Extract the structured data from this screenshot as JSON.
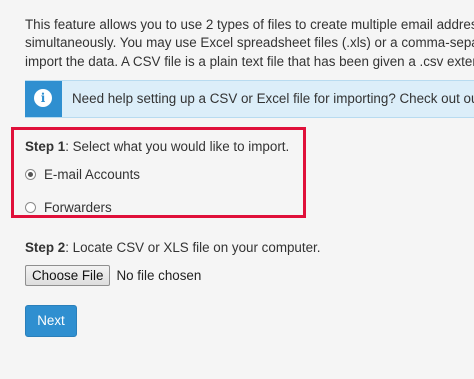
{
  "intro": {
    "line1": "This feature allows you to use 2 types of files to create multiple email addresses",
    "line2": "simultaneously. You may use Excel spreadsheet files (.xls) or a comma-separated",
    "line3": "import the data. A CSV file is a plain text file that has been given a .csv extension"
  },
  "info": {
    "icon": "info-icon",
    "icon_glyph": "i",
    "text": "Need help setting up a CSV or Excel file for importing? Check out our documentation"
  },
  "step1": {
    "label": "Step 1",
    "text": ": Select what you would like to import.",
    "options": [
      {
        "label": "E-mail Accounts",
        "checked": true
      },
      {
        "label": "Forwarders",
        "checked": false
      }
    ],
    "highlight_color": "#e0103a"
  },
  "step2": {
    "label": "Step 2",
    "text": ": Locate CSV or XLS file on your computer.",
    "choose_file_label": "Choose File",
    "no_file_text": "No file chosen"
  },
  "next_button": {
    "label": "Next"
  },
  "colors": {
    "accent": "#2f8fd0",
    "info_background": "#dceef9",
    "page_background": "#f5f5f5"
  }
}
